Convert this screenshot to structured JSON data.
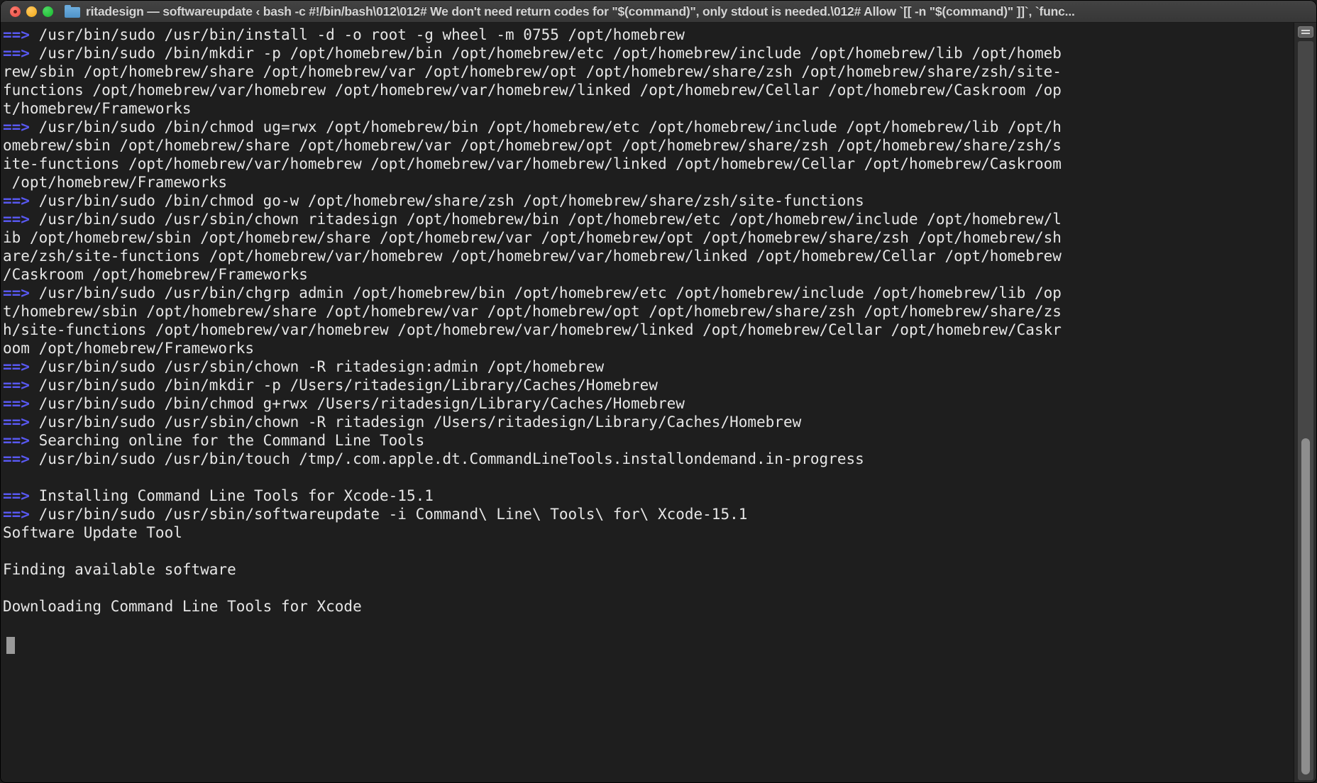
{
  "window": {
    "title": "ritadesign — softwareupdate ‹ bash -c #!/bin/bash\\012\\012# We don't need return codes for \"$(command)\", only stdout is needed.\\012# Allow `[[ -n \"$(command)\" ]]`, `func...",
    "traffic_lights": {
      "close_label": "close-window",
      "minimize_label": "minimize-window",
      "zoom_label": "zoom-window"
    },
    "proxy_icon": "folder-icon"
  },
  "colors": {
    "background": "#1e1e1e",
    "foreground": "#e6e6e6",
    "prompt_arrow": "#5858f0",
    "titlebar": "#3c3c3c",
    "scrollbar_thumb": "#8e8e8e"
  },
  "terminal": {
    "prompt_marker": "==>",
    "cursor": "block-cursor",
    "lines": [
      {
        "marker": true,
        "text": " /usr/bin/sudo /usr/bin/install -d -o root -g wheel -m 0755 /opt/homebrew"
      },
      {
        "marker": true,
        "text": " /usr/bin/sudo /bin/mkdir -p /opt/homebrew/bin /opt/homebrew/etc /opt/homebrew/include /opt/homebrew/lib /opt/homeb"
      },
      {
        "marker": false,
        "text": "rew/sbin /opt/homebrew/share /opt/homebrew/var /opt/homebrew/opt /opt/homebrew/share/zsh /opt/homebrew/share/zsh/site-"
      },
      {
        "marker": false,
        "text": "functions /opt/homebrew/var/homebrew /opt/homebrew/var/homebrew/linked /opt/homebrew/Cellar /opt/homebrew/Caskroom /op"
      },
      {
        "marker": false,
        "text": "t/homebrew/Frameworks"
      },
      {
        "marker": true,
        "text": " /usr/bin/sudo /bin/chmod ug=rwx /opt/homebrew/bin /opt/homebrew/etc /opt/homebrew/include /opt/homebrew/lib /opt/h"
      },
      {
        "marker": false,
        "text": "omebrew/sbin /opt/homebrew/share /opt/homebrew/var /opt/homebrew/opt /opt/homebrew/share/zsh /opt/homebrew/share/zsh/s"
      },
      {
        "marker": false,
        "text": "ite-functions /opt/homebrew/var/homebrew /opt/homebrew/var/homebrew/linked /opt/homebrew/Cellar /opt/homebrew/Caskroom"
      },
      {
        "marker": false,
        "text": " /opt/homebrew/Frameworks"
      },
      {
        "marker": true,
        "text": " /usr/bin/sudo /bin/chmod go-w /opt/homebrew/share/zsh /opt/homebrew/share/zsh/site-functions"
      },
      {
        "marker": true,
        "text": " /usr/bin/sudo /usr/sbin/chown ritadesign /opt/homebrew/bin /opt/homebrew/etc /opt/homebrew/include /opt/homebrew/l"
      },
      {
        "marker": false,
        "text": "ib /opt/homebrew/sbin /opt/homebrew/share /opt/homebrew/var /opt/homebrew/opt /opt/homebrew/share/zsh /opt/homebrew/sh"
      },
      {
        "marker": false,
        "text": "are/zsh/site-functions /opt/homebrew/var/homebrew /opt/homebrew/var/homebrew/linked /opt/homebrew/Cellar /opt/homebrew"
      },
      {
        "marker": false,
        "text": "/Caskroom /opt/homebrew/Frameworks"
      },
      {
        "marker": true,
        "text": " /usr/bin/sudo /usr/bin/chgrp admin /opt/homebrew/bin /opt/homebrew/etc /opt/homebrew/include /opt/homebrew/lib /op"
      },
      {
        "marker": false,
        "text": "t/homebrew/sbin /opt/homebrew/share /opt/homebrew/var /opt/homebrew/opt /opt/homebrew/share/zsh /opt/homebrew/share/zs"
      },
      {
        "marker": false,
        "text": "h/site-functions /opt/homebrew/var/homebrew /opt/homebrew/var/homebrew/linked /opt/homebrew/Cellar /opt/homebrew/Caskr"
      },
      {
        "marker": false,
        "text": "oom /opt/homebrew/Frameworks"
      },
      {
        "marker": true,
        "text": " /usr/bin/sudo /usr/sbin/chown -R ritadesign:admin /opt/homebrew"
      },
      {
        "marker": true,
        "text": " /usr/bin/sudo /bin/mkdir -p /Users/ritadesign/Library/Caches/Homebrew"
      },
      {
        "marker": true,
        "text": " /usr/bin/sudo /bin/chmod g+rwx /Users/ritadesign/Library/Caches/Homebrew"
      },
      {
        "marker": true,
        "text": " /usr/bin/sudo /usr/sbin/chown -R ritadesign /Users/ritadesign/Library/Caches/Homebrew"
      },
      {
        "marker": true,
        "text": " Searching online for the Command Line Tools"
      },
      {
        "marker": true,
        "text": " /usr/bin/sudo /usr/bin/touch /tmp/.com.apple.dt.CommandLineTools.installondemand.in-progress"
      },
      {
        "marker": false,
        "text": ""
      },
      {
        "marker": true,
        "text": " Installing Command Line Tools for Xcode-15.1"
      },
      {
        "marker": true,
        "text": " /usr/bin/sudo /usr/sbin/softwareupdate -i Command\\ Line\\ Tools\\ for\\ Xcode-15.1"
      },
      {
        "marker": false,
        "text": "Software Update Tool"
      },
      {
        "marker": false,
        "text": ""
      },
      {
        "marker": false,
        "text": "Finding available software"
      },
      {
        "marker": false,
        "text": ""
      },
      {
        "marker": false,
        "text": "Downloading Command Line Tools for Xcode"
      },
      {
        "marker": false,
        "text": ""
      }
    ]
  },
  "scrollbar": {
    "top_button": "scroll-settings-button"
  }
}
